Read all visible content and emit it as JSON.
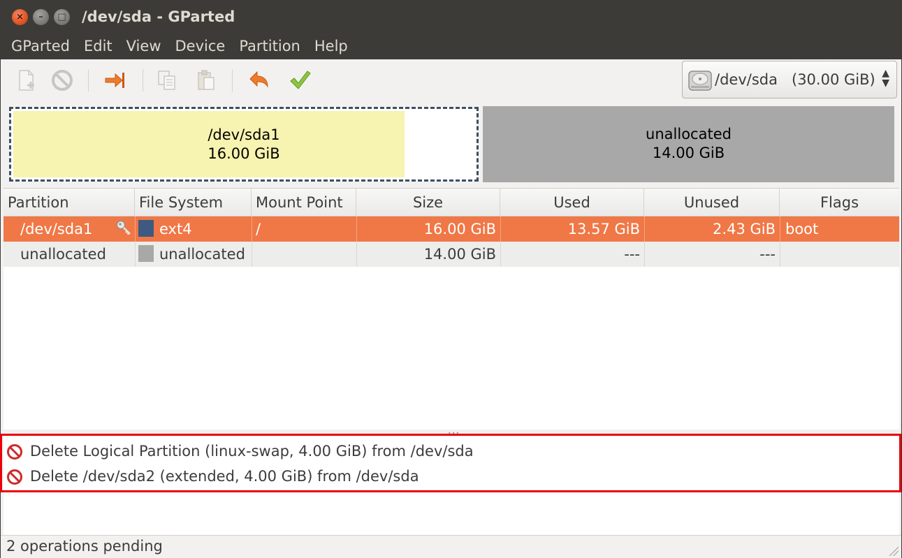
{
  "window": {
    "title": "/dev/sda - GParted",
    "buttons": {
      "close": "×",
      "minimize": "–",
      "maximize": "□"
    }
  },
  "menubar": [
    "GParted",
    "Edit",
    "View",
    "Device",
    "Partition",
    "Help"
  ],
  "toolbar": {
    "buttons": [
      {
        "name": "new-partition",
        "icon": "new-partition-icon",
        "enabled": false
      },
      {
        "name": "delete-partition",
        "icon": "delete-icon",
        "enabled": false
      },
      {
        "name": "resize-move",
        "icon": "resize-move-icon",
        "enabled": true
      },
      {
        "name": "copy",
        "icon": "copy-icon",
        "enabled": false
      },
      {
        "name": "paste",
        "icon": "paste-icon",
        "enabled": false
      },
      {
        "name": "undo",
        "icon": "undo-icon",
        "enabled": true
      },
      {
        "name": "apply",
        "icon": "apply-check-icon",
        "enabled": true
      }
    ],
    "device_selector": {
      "device": "/dev/sda",
      "size": "(30.00 GiB)"
    }
  },
  "disk_map": {
    "partitions": [
      {
        "name": "/dev/sda1",
        "size": "16.00 GiB",
        "used_fraction": 0.848
      },
      {
        "name": "unallocated",
        "size": "14.00 GiB"
      }
    ]
  },
  "table": {
    "headers": [
      "Partition",
      "File System",
      "Mount Point",
      "Size",
      "Used",
      "Unused",
      "Flags"
    ],
    "rows": [
      {
        "partition": "/dev/sda1",
        "filesystem": "ext4",
        "mount": "/",
        "size": "16.00 GiB",
        "used": "13.57 GiB",
        "unused": "2.43 GiB",
        "flags": "boot",
        "fs_color": "#3d5a80",
        "mounted": true,
        "selected": true
      },
      {
        "partition": "unallocated",
        "filesystem": "unallocated",
        "mount": "",
        "size": "14.00 GiB",
        "used": "---",
        "unused": "---",
        "flags": "",
        "fs_color": "#a8a8a8",
        "mounted": false,
        "selected": false
      }
    ]
  },
  "operations": [
    {
      "icon": "delete-icon",
      "text": "Delete Logical Partition (linux-swap, 4.00 GiB) from /dev/sda"
    },
    {
      "icon": "delete-icon",
      "text": "Delete /dev/sda2 (extended, 4.00 GiB) from /dev/sda"
    }
  ],
  "status": {
    "text": "2 operations pending"
  },
  "colors": {
    "accent": "#f07746",
    "unallocated": "#a8a8a8",
    "used_space": "#f7f3b0",
    "highlight_box": "#e8000b"
  }
}
